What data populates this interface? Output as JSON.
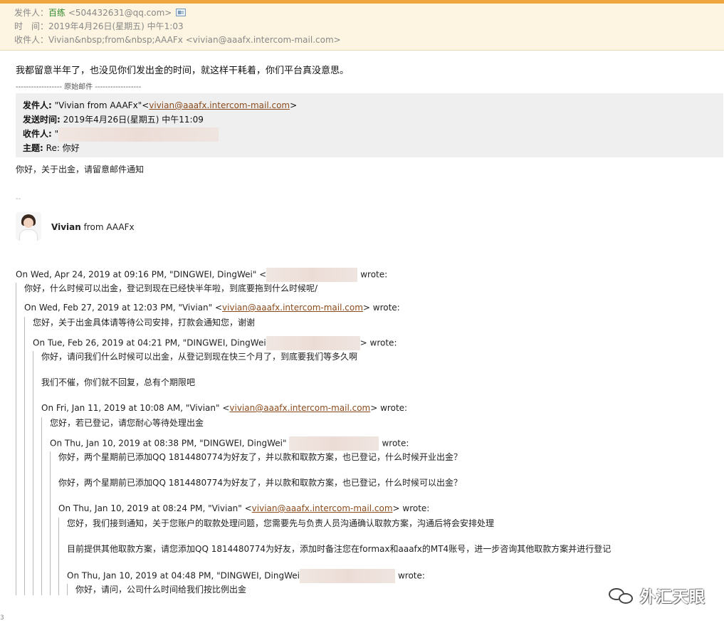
{
  "header": {
    "from_label": "发件人：",
    "from_name": "百练",
    "from_addr": "<504432631@qq.com>",
    "time_label": "时　间：",
    "time_value": "2019年4月26日(星期五) 中午1:03",
    "to_label": "收件人：",
    "to_name": "Vivian&nbsp;from&nbsp;AAAFx",
    "to_addr": "<vivian@aaafx.intercom-mail.com>"
  },
  "body": {
    "main_text": "我都留意半年了，也没见你们发出金的时间，就这样干耗着，你们平台真没意思。",
    "divider": "------------------ 原始邮件 ------------------"
  },
  "original": {
    "from_label": "发件人:",
    "from_value": "\"Vivian from AAAFx\"<",
    "from_link": "vivian@aaafx.intercom-mail.com",
    "from_end": ">",
    "time_label": "发送时间:",
    "time_value": "2019年4月26日(星期五) 中午11:09",
    "to_label": "收件人:",
    "to_value": "\"",
    "subject_label": "主题:",
    "subject_value": "Re: 你好"
  },
  "reply": {
    "greeting": "你好，关于出金，请留意邮件通知",
    "dash": "--",
    "sig_name": "Vivian",
    "sig_suffix": " from AAAFx"
  },
  "thread": {
    "q1_head_a": "On Wed, Apr 24, 2019 at 09:16 PM, \"DINGWEI, DingWei\" <",
    "q1_head_b": "wrote:",
    "q1_line": "你好，什么时候可以出金，登记到现在已经快半年啦，到底要拖到什么时候呢/",
    "q2_head_a": "On Wed, Feb 27, 2019 at 12:03 PM, \"Vivian\" <",
    "q2_link": "vivian@aaafx.intercom-mail.com",
    "q2_head_b": "> wrote:",
    "q2_line": "您好，关于出金具体请等待公司安排，打款会通知您，谢谢",
    "q3_head_a": "On Tue, Feb 26, 2019 at 04:21 PM, \"DINGWEI, DingWei",
    "q3_head_b": "> wrote:",
    "q3_line1": "你好，请问我们什么时候可以出金，从登记到现在快三个月了，到底要我们等多久啊",
    "q3_line2": "我们不催，你们就不回复，总有个期限吧",
    "q4_head_a": "On Fri, Jan 11, 2019 at 10:08 AM, \"Vivian\" <",
    "q4_link": "vivian@aaafx.intercom-mail.com",
    "q4_head_b": "> wrote:",
    "q4_line": "您好，若已登记，请您耐心等待处理出金",
    "q5_head_a": "On Thu, Jan 10, 2019 at 08:38 PM, \"DINGWEI, DingWei\"",
    "q5_head_b": "wrote:",
    "q5_line1": "你好，两个星期前已添加QQ 1814480774为好友了，并以款和取款方案，也已登记，什么时候开业出金？",
    "q5_line2": "你好，两个星期前已添加QQ 1814480774为好友了，并以款和取款方案，也已登记，什么时候可以出金？",
    "q6_head_a": "On Thu, Jan 10, 2019 at 08:24 PM, \"Vivian\" <",
    "q6_link": "vivian@aaafx.intercom-mail.com",
    "q6_head_b": "> wrote:",
    "q6_line1": "您好，我们接到通知，关于您账户的取款处理问题，您需要先与负责人员沟通确认取款方案，沟通后将会安排处理",
    "q6_line2": "目前提供其他取款方案，请您添加QQ 1814480774为好友，添加时备注您在formax和aaafx的MT4账号，进一步咨询其他取款方案并进行登记",
    "q7_head_a": "On Thu, Jan 10, 2019 at 04:48 PM, \"DINGWEI, DingWei",
    "q7_head_b": "wrote:",
    "q7_line": "你好，请问，公司什么时间给我们按比例出金"
  },
  "watermark": {
    "text": "外汇天眼",
    "icon": "wechat-icon"
  },
  "edge_mark": "3"
}
